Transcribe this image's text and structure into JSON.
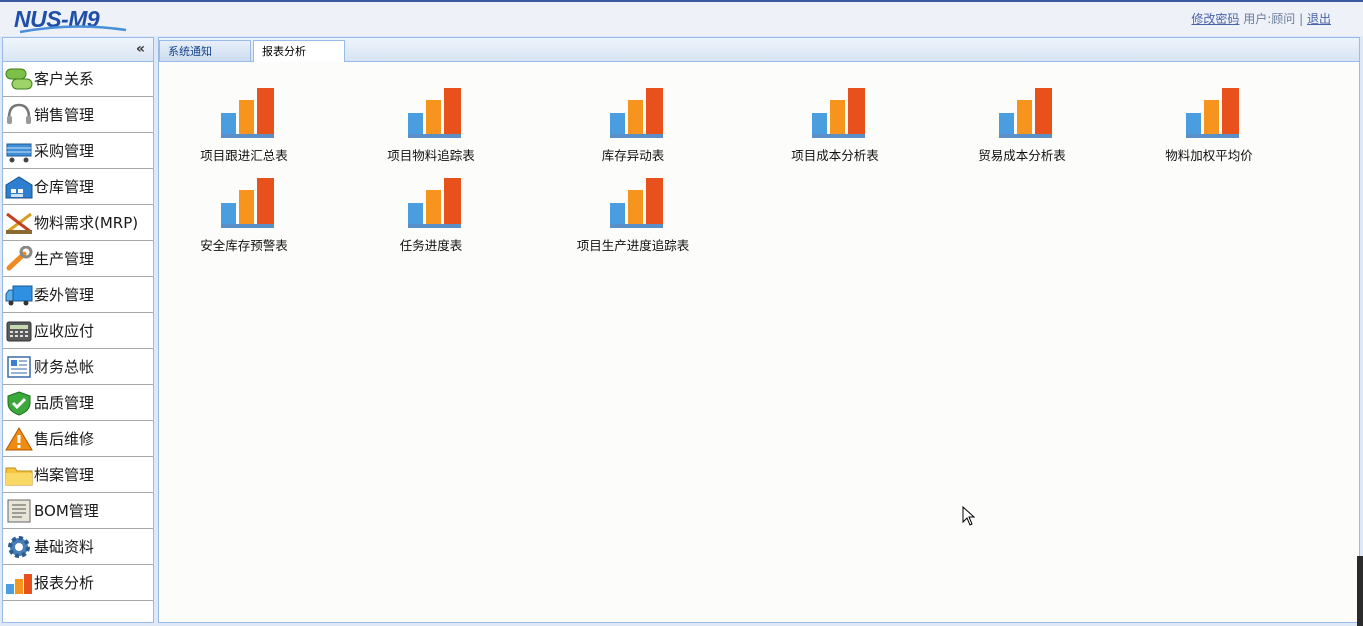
{
  "header": {
    "logo_text": "NUS-M9",
    "change_password": "修改密码",
    "user_text": "用户:顾问",
    "separator": "|",
    "logout": "退出"
  },
  "sidebar": {
    "collapse_glyph": "«",
    "items": [
      {
        "label": "客户关系",
        "icon": "customer-relations-icon"
      },
      {
        "label": "销售管理",
        "icon": "headset-icon"
      },
      {
        "label": "采购管理",
        "icon": "cart-icon"
      },
      {
        "label": "仓库管理",
        "icon": "warehouse-icon"
      },
      {
        "label": "物料需求(MRP)",
        "icon": "tools-icon"
      },
      {
        "label": "生产管理",
        "icon": "wrench-icon"
      },
      {
        "label": "委外管理",
        "icon": "truck-icon"
      },
      {
        "label": "应收应付",
        "icon": "calculator-icon"
      },
      {
        "label": "财务总帐",
        "icon": "ledger-icon"
      },
      {
        "label": "品质管理",
        "icon": "shield-check-icon"
      },
      {
        "label": "售后维修",
        "icon": "warning-icon"
      },
      {
        "label": "档案管理",
        "icon": "folder-icon"
      },
      {
        "label": "BOM管理",
        "icon": "document-icon"
      },
      {
        "label": "基础资料",
        "icon": "gear-icon"
      },
      {
        "label": "报表分析",
        "icon": "bar-chart-icon"
      }
    ]
  },
  "tabs": [
    {
      "label": "系统通知",
      "active": false
    },
    {
      "label": "报表分析",
      "active": true
    }
  ],
  "reports": [
    {
      "label": "项目跟进汇总表"
    },
    {
      "label": "项目物料追踪表"
    },
    {
      "label": "库存异动表"
    },
    {
      "label": "项目成本分析表"
    },
    {
      "label": "贸易成本分析表"
    },
    {
      "label": "物料加权平均价"
    },
    {
      "label": "安全库存预警表"
    },
    {
      "label": "任务进度表"
    },
    {
      "label": "项目生产进度追踪表"
    }
  ],
  "colors": {
    "header_border": "#3a5aa0",
    "panel_border": "#99bbe8",
    "link": "#4a64a8",
    "bar_blue": "#4a9ee0",
    "bar_orange": "#f7941d",
    "bar_red": "#e8501c"
  }
}
